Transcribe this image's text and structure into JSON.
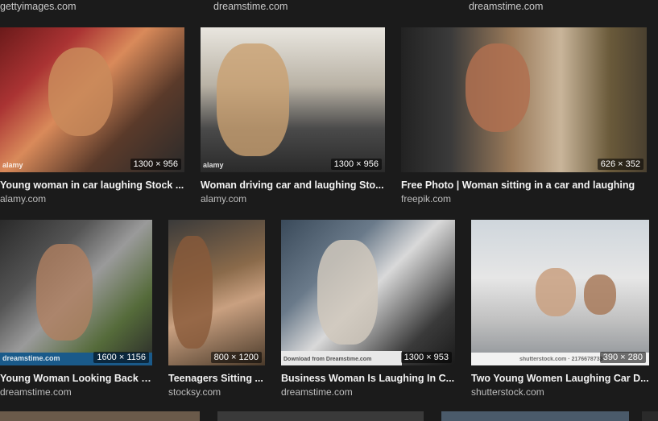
{
  "top_sources": [
    "gettyimages.com",
    "dreamstime.com",
    "dreamstime.com"
  ],
  "row1": [
    {
      "title": "Young woman in car laughing Stock ...",
      "site": "alamy.com",
      "dims": "1300 × 956",
      "wm": "alamy"
    },
    {
      "title": "Woman driving car and laughing Sto...",
      "site": "alamy.com",
      "dims": "1300 × 956",
      "wm": "alamy"
    },
    {
      "title": "Free Photo | Woman sitting in a car and laughing",
      "site": "freepik.com",
      "dims": "626 × 352",
      "wm": ""
    }
  ],
  "row2": [
    {
      "title": "Young Woman Looking Back I...",
      "site": "dreamstime.com",
      "dims": "1600 × 1156",
      "wm": "dreamstime.com"
    },
    {
      "title": "Teenagers Sitting ...",
      "site": "stocksy.com",
      "dims": "800 × 1200",
      "wm": ""
    },
    {
      "title": "Business Woman Is Laughing In C...",
      "site": "dreamstime.com",
      "dims": "1300 × 953",
      "wm": "Download from Dreamstime.com"
    },
    {
      "title": "Two Young Women Laughing Car D...",
      "site": "shutterstock.com",
      "dims": "390 × 280",
      "wm": "shutterstock.com · 2176678733"
    }
  ]
}
